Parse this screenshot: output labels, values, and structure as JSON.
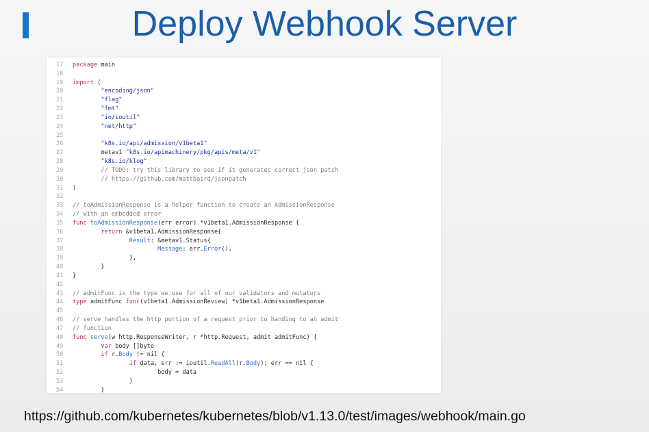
{
  "slide": {
    "title": "Deploy Webhook Server",
    "source_url": "https://github.com/kubernetes/kubernetes/blob/v1.13.0/test/images/webhook/main.go"
  },
  "colors": {
    "title": "#1a5fa6",
    "accent": "#1a73c8",
    "keyword": "#b5306a",
    "string": "#1c2f9c",
    "comment": "#7a7a7a",
    "call": "#3a6fc9"
  },
  "code": {
    "lines": [
      {
        "num": "17",
        "text": "package main"
      },
      {
        "num": "18",
        "text": ""
      },
      {
        "num": "19",
        "text": "import ("
      },
      {
        "num": "20",
        "text": "        \"encoding/json\""
      },
      {
        "num": "21",
        "text": "        \"flag\""
      },
      {
        "num": "22",
        "text": "        \"fmt\""
      },
      {
        "num": "23",
        "text": "        \"io/ioutil\""
      },
      {
        "num": "24",
        "text": "        \"net/http\""
      },
      {
        "num": "25",
        "text": ""
      },
      {
        "num": "26",
        "text": "        \"k8s.io/api/admission/v1beta1\""
      },
      {
        "num": "27",
        "text": "        metav1 \"k8s.io/apimachinery/pkg/apis/meta/v1\""
      },
      {
        "num": "28",
        "text": "        \"k8s.io/klog\""
      },
      {
        "num": "29",
        "text": "        // TODO: try this library to see if it generates correct json patch"
      },
      {
        "num": "30",
        "text": "        // https://github.com/mattbaird/jsonpatch"
      },
      {
        "num": "31",
        "text": ")"
      },
      {
        "num": "32",
        "text": ""
      },
      {
        "num": "33",
        "text": "// toAdmissionResponse is a helper function to create an AdmissionResponse"
      },
      {
        "num": "34",
        "text": "// with an embedded error"
      },
      {
        "num": "35",
        "text": "func toAdmissionResponse(err error) *v1beta1.AdmissionResponse {"
      },
      {
        "num": "36",
        "text": "        return &v1beta1.AdmissionResponse{"
      },
      {
        "num": "37",
        "text": "                Result: &metav1.Status{"
      },
      {
        "num": "38",
        "text": "                        Message: err.Error(),"
      },
      {
        "num": "39",
        "text": "                },"
      },
      {
        "num": "40",
        "text": "        }"
      },
      {
        "num": "41",
        "text": "}"
      },
      {
        "num": "42",
        "text": ""
      },
      {
        "num": "43",
        "text": "// admitFunc is the type we use for all of our validators and mutators"
      },
      {
        "num": "44",
        "text": "type admitFunc func(v1beta1.AdmissionReview) *v1beta1.AdmissionResponse"
      },
      {
        "num": "45",
        "text": ""
      },
      {
        "num": "46",
        "text": "// serve handles the http portion of a request prior to handing to an admit"
      },
      {
        "num": "47",
        "text": "// function"
      },
      {
        "num": "48",
        "text": "func serve(w http.ResponseWriter, r *http.Request, admit admitFunc) {"
      },
      {
        "num": "49",
        "text": "        var body []byte"
      },
      {
        "num": "50",
        "text": "        if r.Body != nil {"
      },
      {
        "num": "51",
        "text": "                if data, err := ioutil.ReadAll(r.Body); err == nil {"
      },
      {
        "num": "52",
        "text": "                        body = data"
      },
      {
        "num": "53",
        "text": "                }"
      },
      {
        "num": "54",
        "text": "        }"
      }
    ]
  }
}
